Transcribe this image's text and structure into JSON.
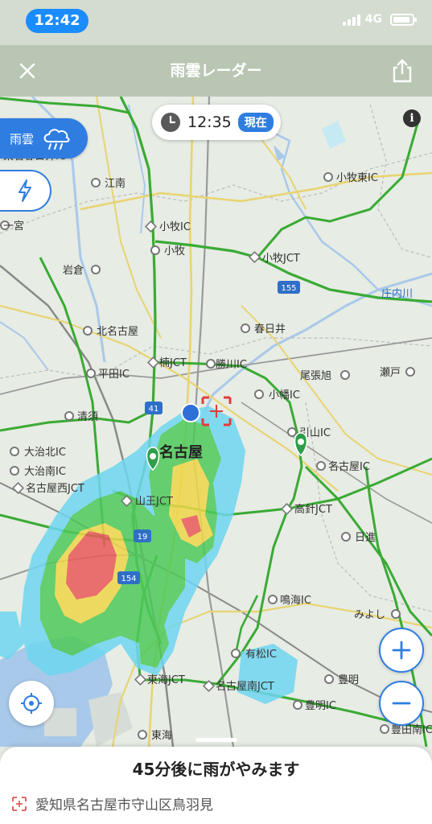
{
  "status_bar": {
    "time": "12:42",
    "network": "4G"
  },
  "header": {
    "title": "雨雲レーダー"
  },
  "radar_time": {
    "time": "12:35",
    "badge": "現在"
  },
  "layer_tabs": {
    "rain_label": "雨雲"
  },
  "map_labels": {
    "places": [
      "江南",
      "小牧東IC",
      "一宮",
      "小牧IC",
      "小牧",
      "小牧JCT",
      "岩倉",
      "庄内川",
      "北名古屋",
      "春日井",
      "楠JCT",
      "勝川IC",
      "尾張旭",
      "瀬戸",
      "平田IC",
      "小幡IC",
      "清須",
      "引山IC",
      "名古屋",
      "大治北IC",
      "大治南IC",
      "名古屋IC",
      "名古屋西JCT",
      "山王JCT",
      "高針JCT",
      "日進",
      "鳴海IC",
      "みよし",
      "有松IC",
      "豊明",
      "東海JCT",
      "名古屋南JCT",
      "豊明IC",
      "東海",
      "豊田南IC",
      "東名春日井IC"
    ],
    "route_shields": [
      "41",
      "155",
      "19",
      "154"
    ]
  },
  "bottom_sheet": {
    "forecast": "45分後に雨がやみます",
    "address": "愛知県名古屋市守山区鳥羽見"
  },
  "colors": {
    "accent": "#2f7de1",
    "header_bg": "#b9c6b3",
    "map_bg": "#e7ece4",
    "expressway": "#3aaa35",
    "rain_light": "#6fd6f0",
    "rain_moderate": "#4fc95a",
    "rain_heavy": "#f0d64a",
    "rain_very_heavy": "#ea5a5a"
  }
}
